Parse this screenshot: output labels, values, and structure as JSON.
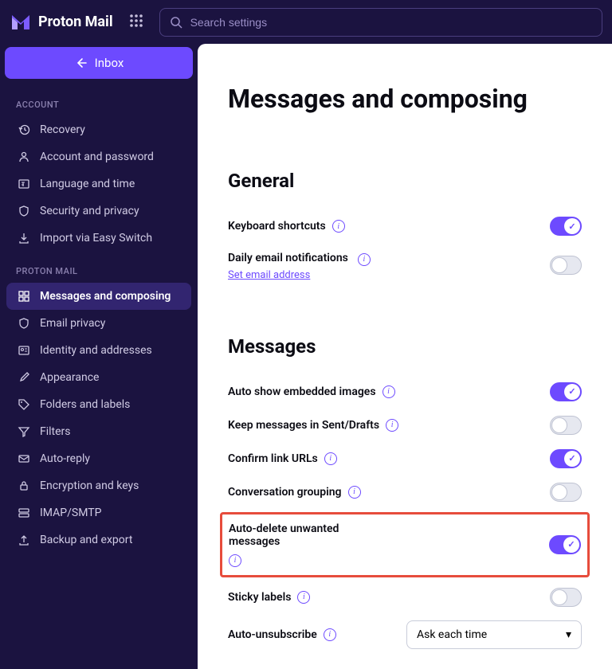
{
  "header": {
    "product": "Proton Mail",
    "search_placeholder": "Search settings"
  },
  "sidebar": {
    "inbox_label": "Inbox",
    "sections": [
      {
        "label": "ACCOUNT",
        "items": [
          {
            "label": "Recovery",
            "icon": "clock-back-icon"
          },
          {
            "label": "Account and password",
            "icon": "person-icon"
          },
          {
            "label": "Language and time",
            "icon": "language-icon"
          },
          {
            "label": "Security and privacy",
            "icon": "shield-icon"
          },
          {
            "label": "Import via Easy Switch",
            "icon": "import-icon"
          }
        ]
      },
      {
        "label": "PROTON MAIL",
        "items": [
          {
            "label": "Messages and composing",
            "icon": "grid-icon",
            "active": true
          },
          {
            "label": "Email privacy",
            "icon": "shield-icon"
          },
          {
            "label": "Identity and addresses",
            "icon": "id-card-icon"
          },
          {
            "label": "Appearance",
            "icon": "paintbrush-icon"
          },
          {
            "label": "Folders and labels",
            "icon": "tag-icon"
          },
          {
            "label": "Filters",
            "icon": "funnel-icon"
          },
          {
            "label": "Auto-reply",
            "icon": "reply-icon"
          },
          {
            "label": "Encryption and keys",
            "icon": "lock-icon"
          },
          {
            "label": "IMAP/SMTP",
            "icon": "server-icon"
          },
          {
            "label": "Backup and export",
            "icon": "export-icon"
          }
        ]
      }
    ]
  },
  "main": {
    "title": "Messages and composing",
    "general": {
      "heading": "General",
      "keyboard_shortcuts": {
        "label": "Keyboard shortcuts",
        "on": true
      },
      "daily_notifications": {
        "label": "Daily email notifications",
        "on": false,
        "sublink": "Set email address"
      }
    },
    "messages": {
      "heading": "Messages",
      "auto_show_images": {
        "label": "Auto show embedded images",
        "on": true
      },
      "keep_sent_drafts": {
        "label": "Keep messages in Sent/Drafts",
        "on": false
      },
      "confirm_urls": {
        "label": "Confirm link URLs",
        "on": true
      },
      "conversation_grouping": {
        "label": "Conversation grouping",
        "on": false
      },
      "auto_delete": {
        "label": "Auto-delete unwanted messages",
        "on": true,
        "highlighted": true
      },
      "sticky_labels": {
        "label": "Sticky labels",
        "on": false
      },
      "auto_unsubscribe": {
        "label": "Auto-unsubscribe",
        "value": "Ask each time"
      }
    }
  }
}
